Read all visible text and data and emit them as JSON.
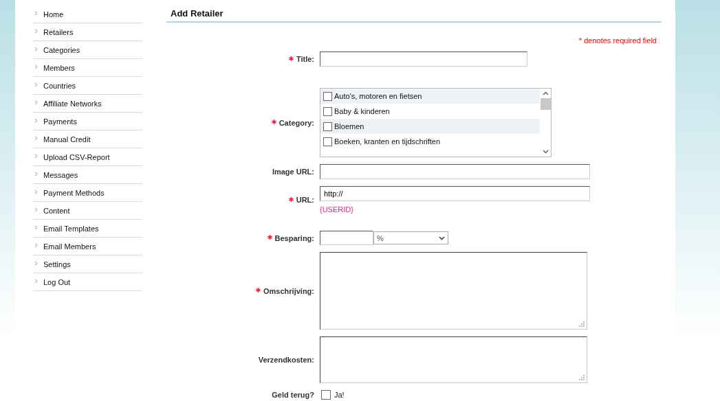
{
  "sidebar": {
    "items": [
      {
        "label": "Home"
      },
      {
        "label": "Retailers"
      },
      {
        "label": "Categories"
      },
      {
        "label": "Members"
      },
      {
        "label": "Countries"
      },
      {
        "label": "Affiliate Networks"
      },
      {
        "label": "Payments"
      },
      {
        "label": "Manual Credit"
      },
      {
        "label": "Upload CSV-Report"
      },
      {
        "label": "Messages"
      },
      {
        "label": "Payment Methods"
      },
      {
        "label": "Content"
      },
      {
        "label": "Email Templates"
      },
      {
        "label": "Email Members"
      },
      {
        "label": "Settings"
      },
      {
        "label": "Log Out"
      }
    ]
  },
  "heading": "Add Retailer",
  "required_note": "* denotes required field",
  "form": [
    {
      "kind": "text",
      "label": "Title:",
      "required": true
    },
    {
      "kind": "checklist",
      "label": "Category:",
      "required": true,
      "options": [
        {
          "label": "Auto's, motoren en fietsen",
          "checked": false
        },
        {
          "label": "Baby & kinderen",
          "checked": false
        },
        {
          "label": "Bloemen",
          "checked": false
        },
        {
          "label": "Boeken, kranten en tijdschriften",
          "checked": false
        }
      ]
    },
    {
      "kind": "text",
      "label": "Image URL:",
      "required": false
    },
    {
      "kind": "text",
      "label": "URL:",
      "required": true,
      "value": "http://",
      "hint": "{USERID}"
    },
    {
      "kind": "amount",
      "label": "Besparing:",
      "required": true,
      "unit": "%"
    },
    {
      "kind": "textarea",
      "label": "Omschrijving:",
      "required": true
    },
    {
      "kind": "textarea",
      "label": "Verzendkosten:",
      "required": false
    },
    {
      "kind": "checkbox",
      "label": "Geld terug?",
      "required": false,
      "option": "Ja!",
      "checked": false
    }
  ]
}
